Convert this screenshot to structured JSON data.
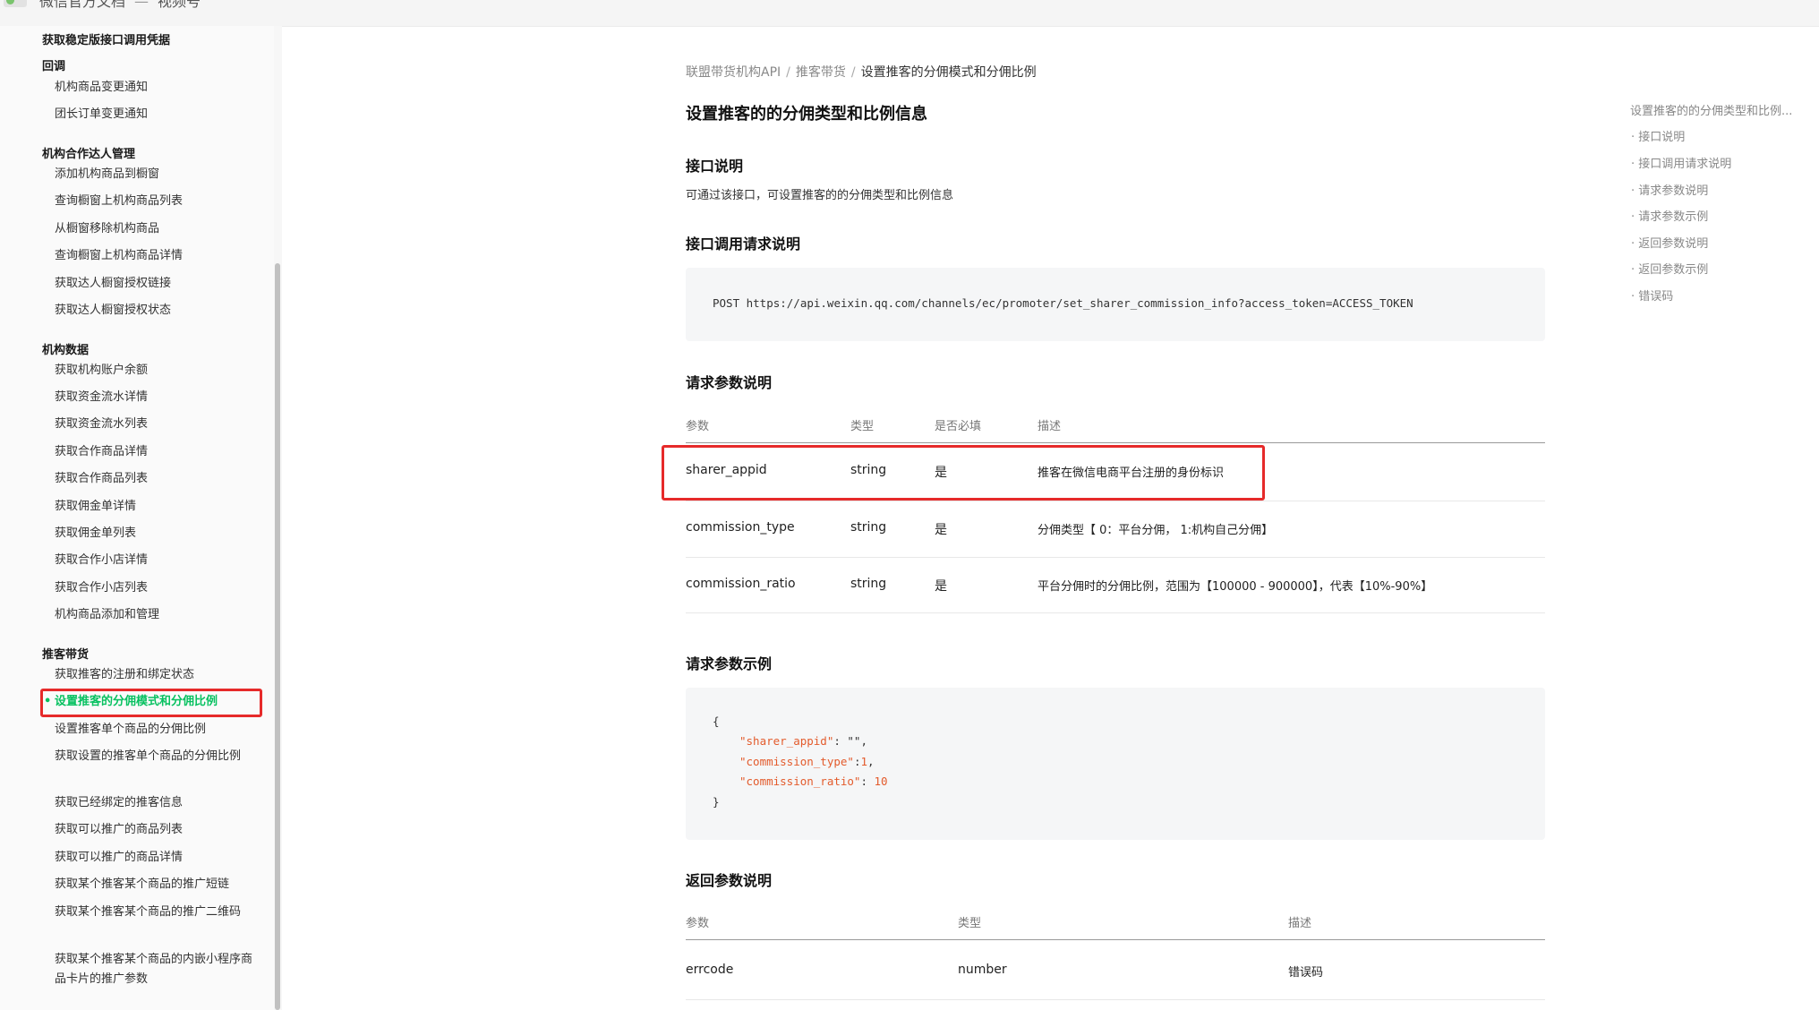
{
  "topbar": {
    "title": "微信官方文档",
    "section": "视频号"
  },
  "sidebar": {
    "item_stable_token": "获取稳定版接口调用凭据",
    "group_callback": "回调",
    "callback_items": [
      "机构商品变更通知",
      "团长订单变更通知"
    ],
    "group_talent": "机构合作达人管理",
    "talent_items": [
      "添加机构商品到橱窗",
      "查询橱窗上机构商品列表",
      "从橱窗移除机构商品",
      "查询橱窗上机构商品详情",
      "获取达人橱窗授权链接",
      "获取达人橱窗授权状态"
    ],
    "group_data": "机构数据",
    "data_items": [
      "获取机构账户余额",
      "获取资金流水详情",
      "获取资金流水列表",
      "获取合作商品详情",
      "获取合作商品列表",
      "获取佣金单详情",
      "获取佣金单列表",
      "获取合作小店详情",
      "获取合作小店列表",
      "机构商品添加和管理"
    ],
    "group_promoter": "推客带货",
    "promoter_items": [
      "获取推客的注册和绑定状态",
      "设置推客的分佣模式和分佣比例",
      "设置推客单个商品的分佣比例",
      "获取设置的推客单个商品的分佣比例",
      "获取已经绑定的推客信息",
      "获取可以推广的商品列表",
      "获取可以推广的商品详情",
      "获取某个推客某个商品的推广短链",
      "获取某个推客某个商品的推广二维码",
      "获取某个推客某个商品的内嵌小程序商品卡片的推广参数"
    ]
  },
  "breadcrumb": [
    "联盟带货机构API",
    "推客带货",
    "设置推客的分佣模式和分佣比例"
  ],
  "page_title": "设置推客的的分佣类型和比例信息",
  "sections": {
    "desc_title": "接口说明",
    "desc_text": "可通过该接口，可设置推客的的分佣类型和比例信息",
    "request_title": "接口调用请求说明",
    "request_line": "POST https://api.weixin.qq.com/channels/ec/promoter/set_sharer_commission_info?access_token=ACCESS_TOKEN",
    "params_title": "请求参数说明",
    "example_title": "请求参数示例",
    "return_title": "返回参数说明"
  },
  "params_table": {
    "headers": [
      "参数",
      "类型",
      "是否必填",
      "描述"
    ],
    "rows": [
      [
        "sharer_appid",
        "string",
        "是",
        "推客在微信电商平台注册的身份标识"
      ],
      [
        "commission_type",
        "string",
        "是",
        "分佣类型【 0：平台分佣， 1:机构自己分佣】"
      ],
      [
        "commission_ratio",
        "string",
        "是",
        "平台分佣时的分佣比例，范围为【100000 - 900000】，代表【10%-90%】"
      ]
    ]
  },
  "example_code": {
    "open": "{",
    "k1": "\"sharer_appid\"",
    "v1": ": \"\",",
    "k2": "\"commission_type\"",
    "v2a": ":",
    "v2b": "1",
    "v2c": ",",
    "k3": "\"commission_ratio\"",
    "v3a": ": ",
    "v3b": "10",
    "close": "}"
  },
  "return_table": {
    "headers": [
      "参数",
      "类型",
      "描述"
    ],
    "rows": [
      [
        "errcode",
        "number",
        "错误码"
      ]
    ]
  },
  "toc": {
    "head": "设置推客的的分佣类型和比例...",
    "items": [
      "接口说明",
      "接口调用请求说明",
      "请求参数说明",
      "请求参数示例",
      "返回参数说明",
      "返回参数示例",
      "错误码"
    ]
  },
  "colors": {
    "accent": "#07c160",
    "highlight": "#e62a2a",
    "code_key": "#e35b2c"
  }
}
